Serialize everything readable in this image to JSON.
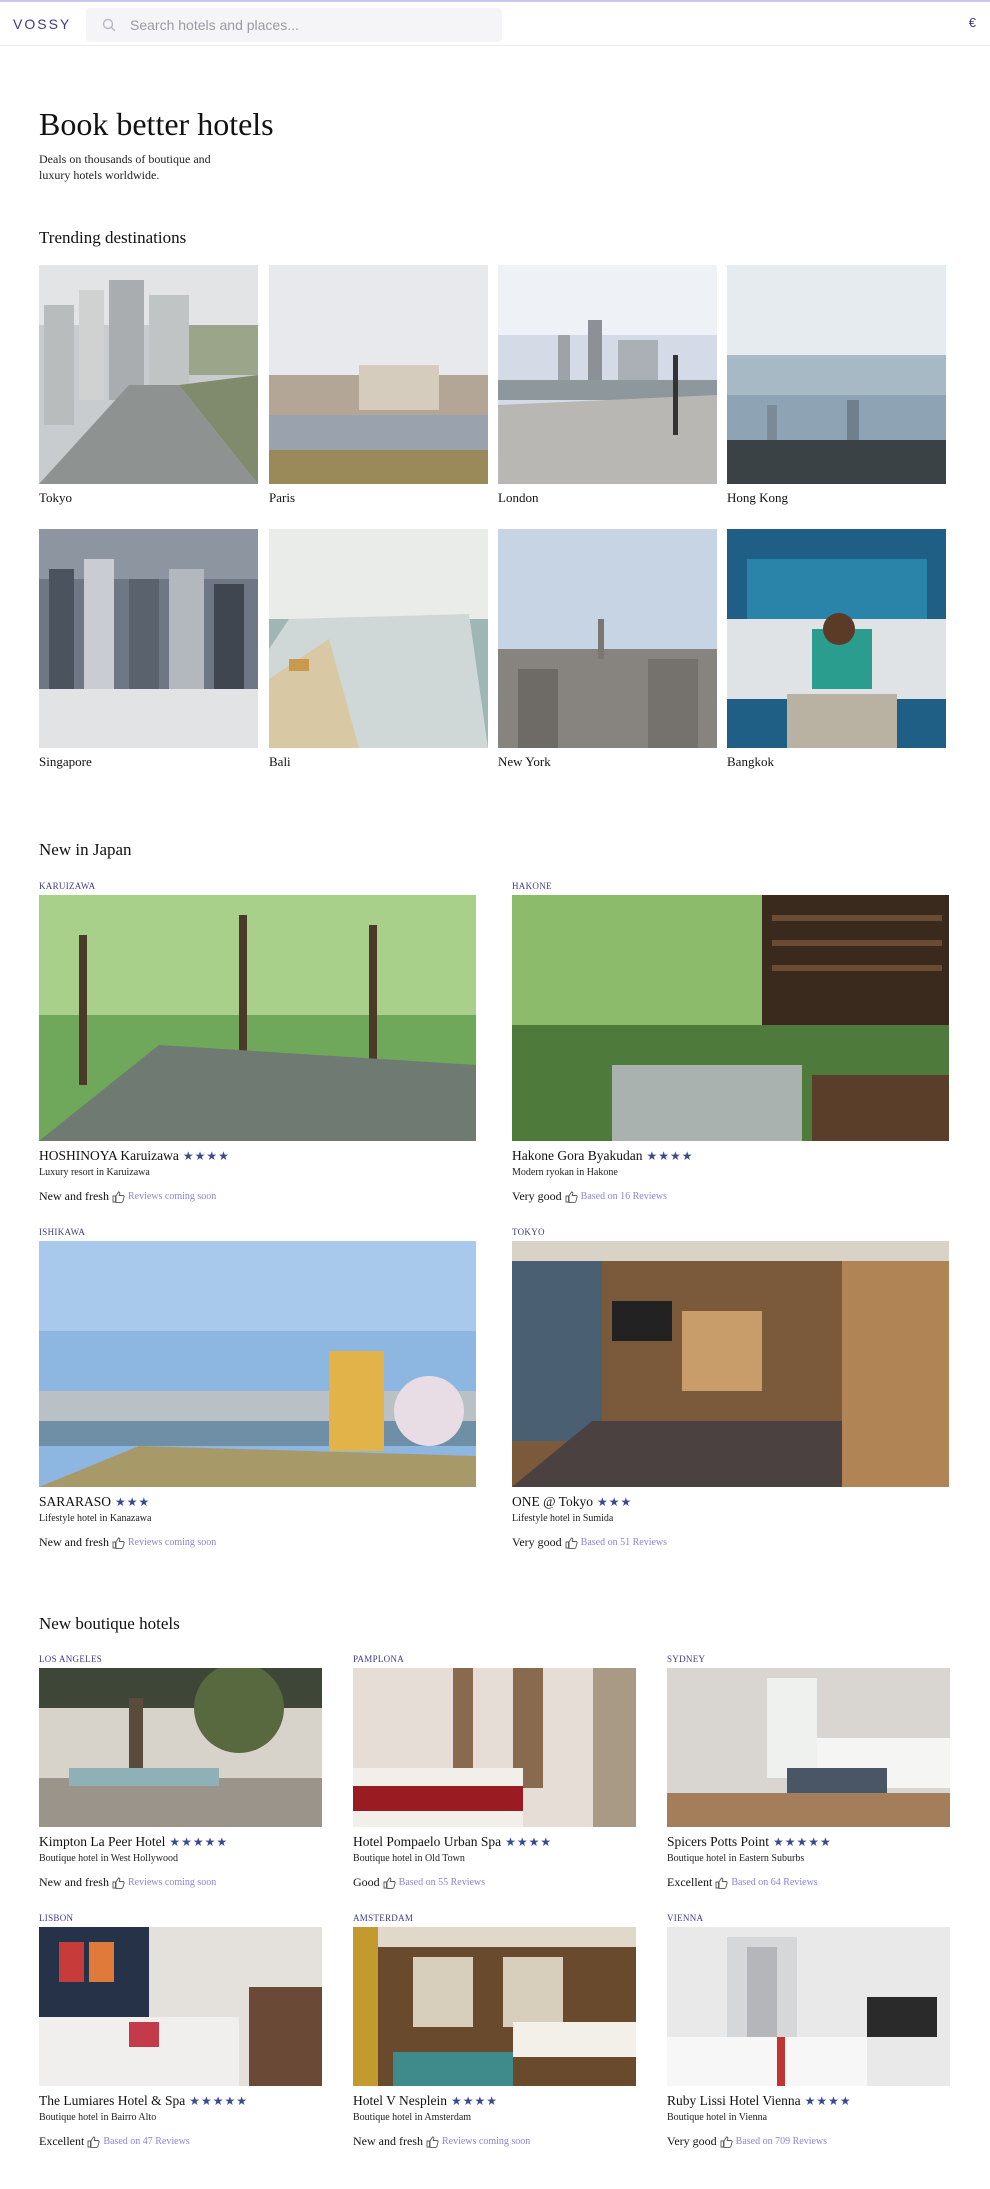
{
  "header": {
    "logo": "VOSSY",
    "search_placeholder": "Search hotels and places...",
    "currency": "€"
  },
  "hero": {
    "title": "Book better hotels",
    "subtitle": "Deals on thousands of boutique and luxury hotels worldwide."
  },
  "trending": {
    "title": "Trending destinations",
    "items": [
      {
        "name": "Tokyo",
        "icon": "city-photo"
      },
      {
        "name": "Paris",
        "icon": "city-photo"
      },
      {
        "name": "London",
        "icon": "city-photo"
      },
      {
        "name": "Hong Kong",
        "icon": "city-photo"
      },
      {
        "name": "Singapore",
        "icon": "city-photo"
      },
      {
        "name": "Bali",
        "icon": "beach-photo"
      },
      {
        "name": "New York",
        "icon": "city-photo"
      },
      {
        "name": "Bangkok",
        "icon": "tuktuk-photo"
      }
    ]
  },
  "japan": {
    "title": "New in Japan",
    "hotels": [
      {
        "region": "KARUIZAWA",
        "name": "HOSHINOYA Karuizawa",
        "stars": "★★★★",
        "desc": "Luxury resort in Karuizawa",
        "rating": "New and fresh",
        "reviews": "Reviews coming soon"
      },
      {
        "region": "HAKONE",
        "name": "Hakone Gora Byakudan",
        "stars": "★★★★",
        "desc": "Modern ryokan in Hakone",
        "rating": "Very good",
        "reviews": "Based on 16 Reviews"
      },
      {
        "region": "ISHIKAWA",
        "name": "SARARASO",
        "stars": "★★★",
        "desc": "Lifestyle hotel in Kanazawa",
        "rating": "New and fresh",
        "reviews": "Reviews coming soon"
      },
      {
        "region": "TOKYO",
        "name": "ONE @ Tokyo",
        "stars": "★★★",
        "desc": "Lifestyle hotel in Sumida",
        "rating": "Very good",
        "reviews": "Based on 51 Reviews"
      }
    ]
  },
  "boutique": {
    "title": "New boutique hotels",
    "hotels": [
      {
        "region": "LOS ANGELES",
        "name": "Kimpton La Peer Hotel",
        "stars": "★★★★★",
        "desc": "Boutique hotel in West Hollywood",
        "rating": "New and fresh",
        "reviews": "Reviews coming soon"
      },
      {
        "region": "PAMPLONA",
        "name": "Hotel Pompaelo Urban Spa",
        "stars": "★★★★",
        "desc": "Boutique hotel in Old Town",
        "rating": "Good",
        "reviews": "Based on 55 Reviews"
      },
      {
        "region": "SYDNEY",
        "name": "Spicers Potts Point",
        "stars": "★★★★★",
        "desc": "Boutique hotel in Eastern Suburbs",
        "rating": "Excellent",
        "reviews": "Based on 64 Reviews"
      },
      {
        "region": "LISBON",
        "name": "The Lumiares Hotel & Spa",
        "stars": "★★★★★",
        "desc": "Boutique hotel in Bairro Alto",
        "rating": "Excellent",
        "reviews": "Based on 47 Reviews"
      },
      {
        "region": "AMSTERDAM",
        "name": "Hotel V Nesplein",
        "stars": "★★★★",
        "desc": "Boutique hotel in Amsterdam",
        "rating": "New and fresh",
        "reviews": "Reviews coming soon"
      },
      {
        "region": "VIENNA",
        "name": "Ruby Lissi Hotel Vienna",
        "stars": "★★★★",
        "desc": "Boutique hotel in Vienna",
        "rating": "Very good",
        "reviews": "Based on 709 Reviews"
      }
    ]
  },
  "colors": {
    "brand": "#3d3a86",
    "stars": "#3b4a8f",
    "reviews_link": "#8b86d6"
  }
}
